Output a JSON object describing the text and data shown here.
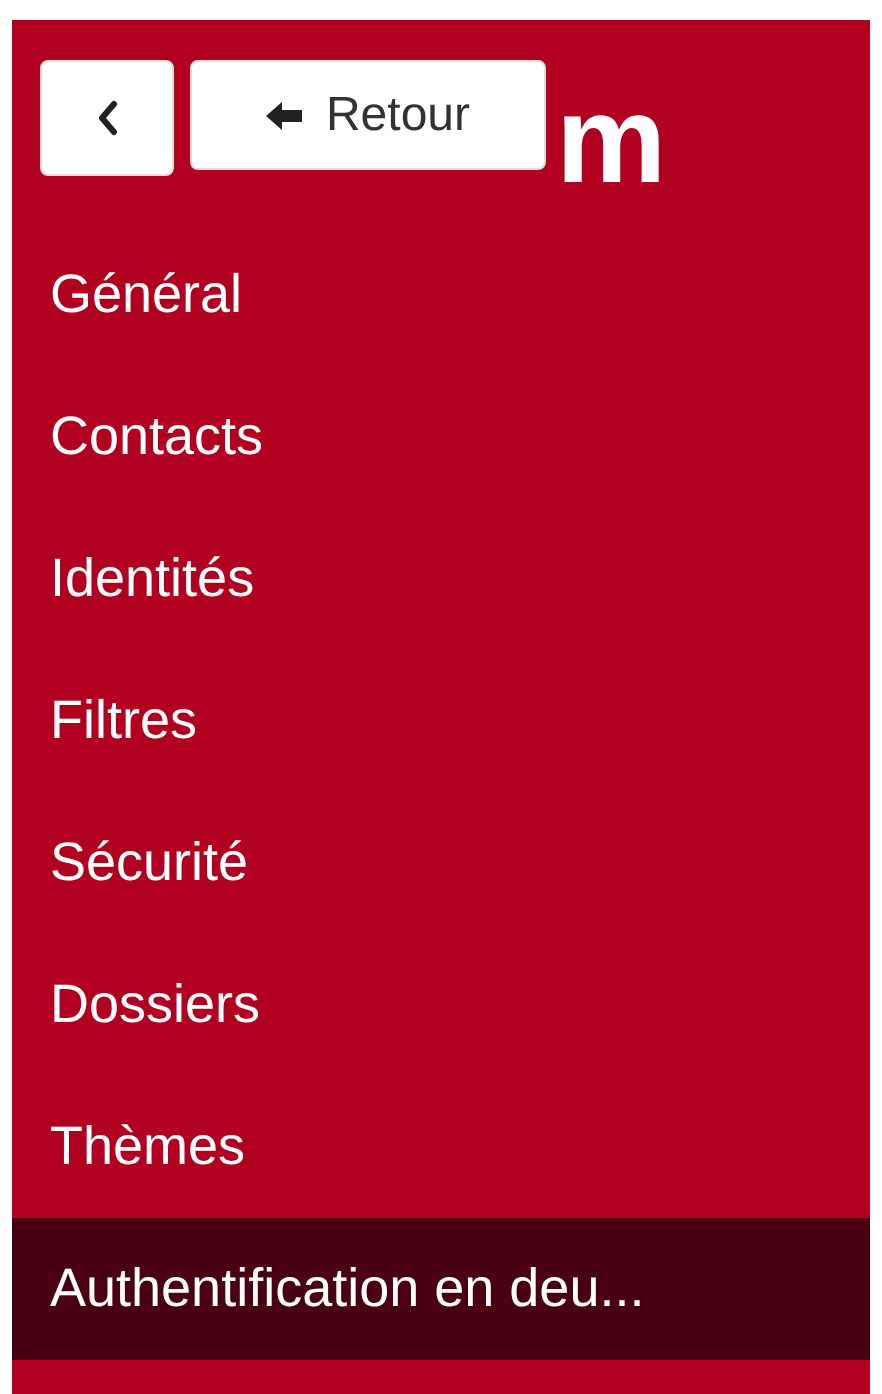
{
  "header": {
    "back_button": {
      "label": "Retour"
    },
    "logo_text": "m"
  },
  "menu": [
    {
      "label": "Général",
      "selected": false
    },
    {
      "label": "Contacts",
      "selected": false
    },
    {
      "label": "Identités",
      "selected": false
    },
    {
      "label": "Filtres",
      "selected": false
    },
    {
      "label": "Sécurité",
      "selected": false
    },
    {
      "label": "Dossiers",
      "selected": false
    },
    {
      "label": "Thèmes",
      "selected": false
    },
    {
      "label": "Authentification en deu...",
      "selected": true
    }
  ]
}
